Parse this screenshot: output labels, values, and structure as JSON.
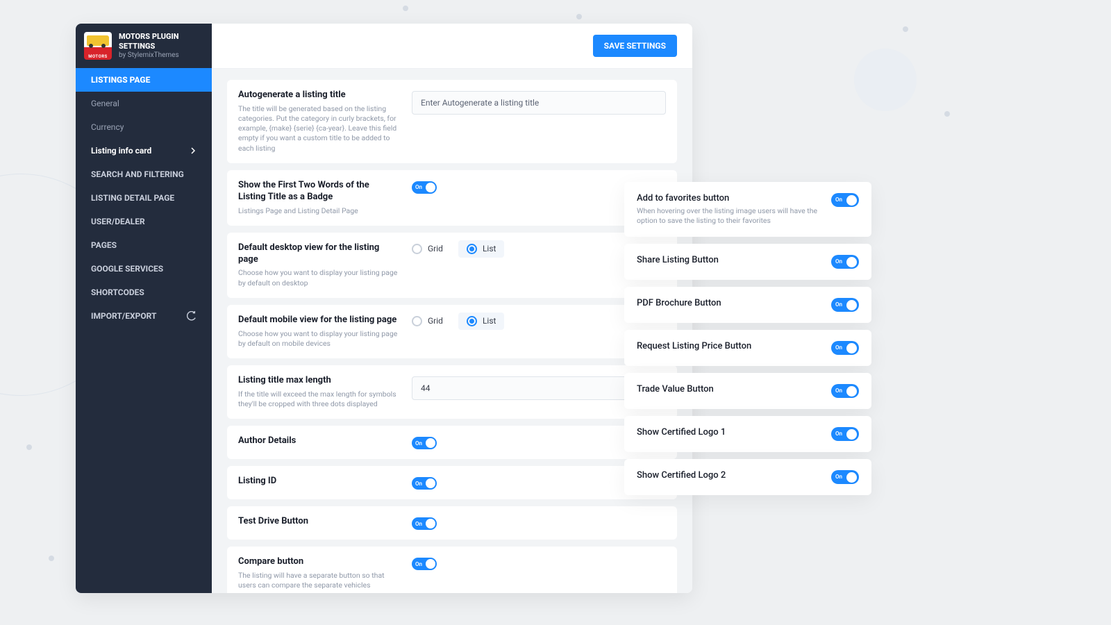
{
  "header": {
    "title1": "MOTORS PLUGIN",
    "title2": "SETTINGS",
    "byline": "by StylemixThemes",
    "logo_label": "MOTORS"
  },
  "save_label": "SAVE SETTINGS",
  "nav": {
    "active_section": "LISTINGS PAGE",
    "subs": [
      "General",
      "Currency",
      "Listing info card"
    ],
    "current_sub_index": 2,
    "items": [
      "SEARCH AND FILTERING",
      "LISTING DETAIL PAGE",
      "USER/DEALER",
      "PAGES",
      "GOOGLE SERVICES",
      "SHORTCODES",
      "IMPORT/EXPORT"
    ]
  },
  "settings": {
    "autotitle": {
      "title": "Autogenerate a listing title",
      "desc": "The title will be generated based on the listing categories. Put the category in curly brackets, for example, {make} {serie} {ca-year}. Leave this field empty if you want a custom title to be added to each listing",
      "placeholder": "Enter Autogenerate a listing title",
      "value": ""
    },
    "badge": {
      "title": "Show the First Two Words of the Listing Title as a Badge",
      "desc": "Listings Page and Listing Detail Page",
      "on": true
    },
    "desktop_view": {
      "title": "Default desktop view for the listing page",
      "desc": "Choose how you want to display your listing page by default on desktop",
      "options": [
        "Grid",
        "List"
      ],
      "selected": "List"
    },
    "mobile_view": {
      "title": "Default mobile view for the listing page",
      "desc": "Choose how you want to display your listing page by default on mobile devices",
      "options": [
        "Grid",
        "List"
      ],
      "selected": "List"
    },
    "maxlen": {
      "title": "Listing title max length",
      "desc": "If the title will exceed the max length for symbols they'll be cropped with three dots displayed",
      "value": "44"
    },
    "author": {
      "title": "Author Details",
      "on": true
    },
    "listing_id": {
      "title": "Listing ID",
      "on": true
    },
    "testdrive": {
      "title": "Test Drive Button",
      "on": true
    },
    "compare": {
      "title": "Compare button",
      "desc": "The listing will have a separate button so that users can compare the separate vehicles",
      "on": true
    }
  },
  "panel2": [
    {
      "title": "Add to favorites button",
      "desc": "When hovering over the listing image users will have the option to save the listing to their favorites",
      "on": true
    },
    {
      "title": "Share Listing Button",
      "on": true
    },
    {
      "title": "PDF Brochure Button",
      "on": true
    },
    {
      "title": "Request Listing Price Button",
      "on": true
    },
    {
      "title": "Trade Value Button",
      "on": true
    },
    {
      "title": "Show Certified Logo 1",
      "on": true
    },
    {
      "title": "Show Certified Logo 2",
      "on": true
    }
  ],
  "toggle_on_label": "On"
}
